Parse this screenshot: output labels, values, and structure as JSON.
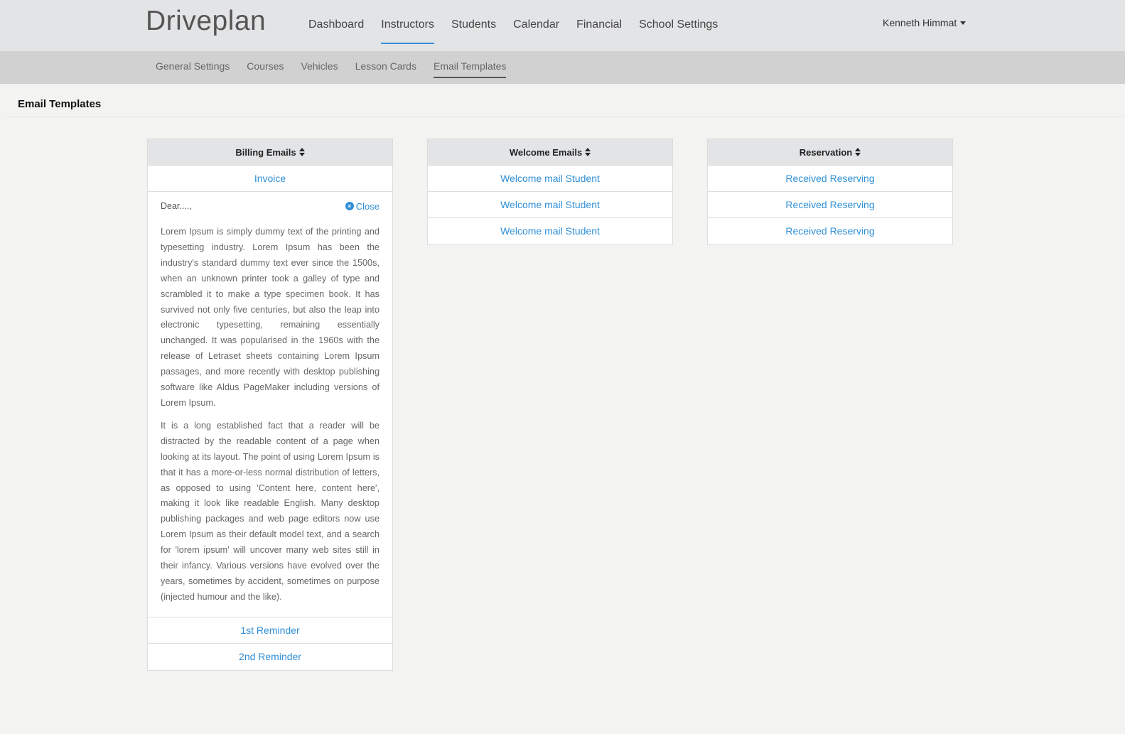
{
  "header": {
    "brand": "Driveplan",
    "nav": [
      "Dashboard",
      "Instructors",
      "Students",
      "Calendar",
      "Financial",
      "School Settings"
    ],
    "active_nav": "Instructors",
    "user_name": "Kenneth Himmat"
  },
  "subnav": {
    "items": [
      "General Settings",
      "Courses",
      "Vehicles",
      "Lesson Cards",
      "Email Templates"
    ],
    "active": "Email Templates"
  },
  "page": {
    "title": "Email Templates"
  },
  "panels": {
    "billing": {
      "title": "Billing Emails",
      "items": [
        "Invoice",
        "1st Reminder",
        "2nd Reminder"
      ],
      "expanded": {
        "greeting": "Dear....,",
        "close_label": "Close",
        "paragraphs": [
          "Lorem Ipsum is simply dummy text of the printing and typesetting industry. Lorem Ipsum has been the industry's standard dummy text ever since the 1500s, when an unknown printer took a galley of type and scrambled it to make a type specimen book. It has survived not only five centuries, but also the leap into electronic typesetting, remaining essentially unchanged. It was popularised in the 1960s with the release of Letraset sheets containing Lorem Ipsum passages, and more recently with desktop publishing software like Aldus PageMaker including versions of Lorem Ipsum.",
          "It is a long established fact that a reader will be distracted by the readable content of a page when looking at its layout. The point of using Lorem Ipsum is that it has a more-or-less normal distribution of letters, as opposed to using 'Content here, content here', making it look like readable English. Many desktop publishing packages and web page editors now use Lorem Ipsum as their default model text, and a search for 'lorem ipsum' will uncover many web sites still in their infancy. Various versions have evolved over the years, sometimes by accident, sometimes on purpose (injected humour and the like)."
        ]
      }
    },
    "welcome": {
      "title": "Welcome Emails",
      "items": [
        "Welcome mail Student",
        "Welcome mail Student",
        "Welcome mail Student"
      ]
    },
    "reservation": {
      "title": "Reservation",
      "items": [
        "Received Reserving",
        "Received Reserving",
        "Received Reserving"
      ]
    }
  },
  "colors": {
    "link": "#2f8fd6",
    "active_tab_underline": "#3a8fd8",
    "topbar_bg": "#e3e4e6",
    "subbar_bg": "#d1d1d1",
    "page_bg": "#f3f4f1"
  }
}
